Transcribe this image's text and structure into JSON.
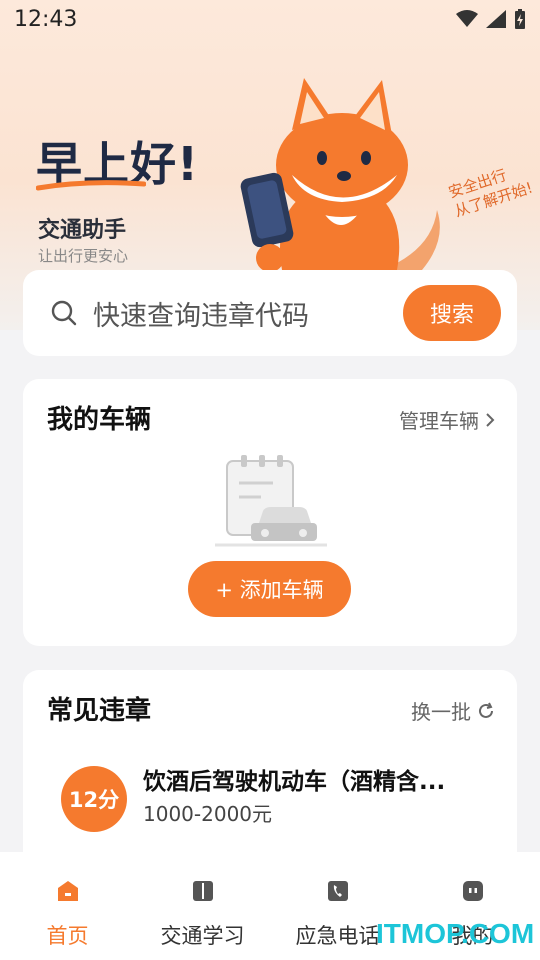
{
  "status": {
    "time": "12:43"
  },
  "hero": {
    "greeting": "早上好!",
    "app_name": "交通助手",
    "slogan": "让出行更安心",
    "side_note_line1": "安全出行",
    "side_note_line2": "从了解开始!"
  },
  "search": {
    "placeholder": "快速查询违章代码",
    "button": "搜索"
  },
  "vehicles": {
    "title": "我的车辆",
    "manage": "管理车辆",
    "add_button": "+ 添加车辆"
  },
  "violations": {
    "title": "常见违章",
    "refresh": "换一批",
    "items": [
      {
        "score": "12分",
        "title": "饮酒后驾驶机动车（酒精含...",
        "fine": "1000-2000元"
      }
    ]
  },
  "tabs": [
    {
      "label": "首页",
      "icon": "home-icon",
      "active": true
    },
    {
      "label": "交通学习",
      "icon": "book-icon",
      "active": false
    },
    {
      "label": "应急电话",
      "icon": "phone-icon",
      "active": false
    },
    {
      "label": "我的",
      "icon": "profile-icon",
      "active": false
    }
  ],
  "watermark": "ITMOP.COM",
  "colors": {
    "accent": "#f57a2e",
    "hero_bg": "#fde9db",
    "page_bg": "#f3f3f5"
  }
}
